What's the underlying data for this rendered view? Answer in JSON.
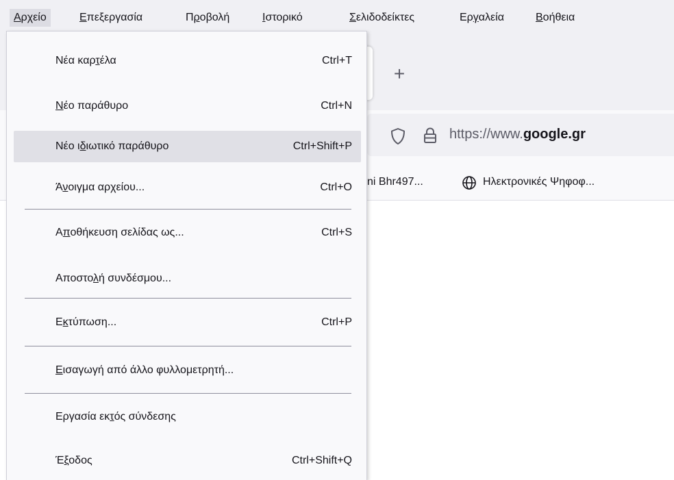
{
  "menubar": {
    "items": [
      {
        "pre": "",
        "ul": "Α",
        "post": "ρχείο"
      },
      {
        "pre": "",
        "ul": "Ε",
        "post": "πεξεργασία"
      },
      {
        "pre": "Π",
        "ul": "ρ",
        "post": "οβολή"
      },
      {
        "pre": "",
        "ul": "Ι",
        "post": "στορικό"
      },
      {
        "pre": "",
        "ul": "Σ",
        "post": "ελιδοδείκτες"
      },
      {
        "pre": "Ερ",
        "ul": "γ",
        "post": "αλεία"
      },
      {
        "pre": "",
        "ul": "Β",
        "post": "οήθεια"
      }
    ]
  },
  "tabs": {
    "new_tab_label": "+"
  },
  "navbar": {
    "url_prefix": "https://www.",
    "url_domain": "google.gr",
    "shield_icon": "shield-icon",
    "lock_icon": "lock-icon"
  },
  "bookmarks": {
    "items": [
      "ni Bhr497...",
      "Ηλεκτρονικές Ψηφοφ..."
    ],
    "globe_icon": "globe-icon"
  },
  "file_menu": {
    "items": [
      {
        "pre": "Νέα καρ",
        "ul": "τ",
        "post": "έλα",
        "shortcut": "Ctrl+T"
      },
      {
        "pre": "",
        "ul": "Ν",
        "post": "έο παράθυρο",
        "shortcut": "Ctrl+N"
      },
      {
        "pre": "Νέο ι",
        "ul": "δ",
        "post": "ιωτικό παράθυρο",
        "shortcut": "Ctrl+Shift+P"
      },
      {
        "pre": "Ά",
        "ul": "ν",
        "post": "οιγμα αρχείου...",
        "shortcut": "Ctrl+O"
      },
      {
        "pre": "Α",
        "ul": "π",
        "post": "οθήκευση σελίδας ως...",
        "shortcut": "Ctrl+S"
      },
      {
        "pre": "Αποστο",
        "ul": "λ",
        "post": "ή συνδέσμου...",
        "shortcut": ""
      },
      {
        "pre": "Ε",
        "ul": "κ",
        "post": "τύπωση...",
        "shortcut": "Ctrl+P"
      },
      {
        "pre": "",
        "ul": "Ε",
        "post": "ισαγωγή από άλλο φυλλομετρητή...",
        "shortcut": ""
      },
      {
        "pre": "Εργασία εκ",
        "ul": "τ",
        "post": "ός σύνδεσης",
        "shortcut": ""
      },
      {
        "pre": "Έ",
        "ul": "ξ",
        "post": "οδος",
        "shortcut": "Ctrl+Shift+Q"
      }
    ]
  },
  "colors": {
    "highlight": "#e0e0e6",
    "menu_bg": "#f9f9fb",
    "chrome_bg": "#f0f0f4"
  }
}
